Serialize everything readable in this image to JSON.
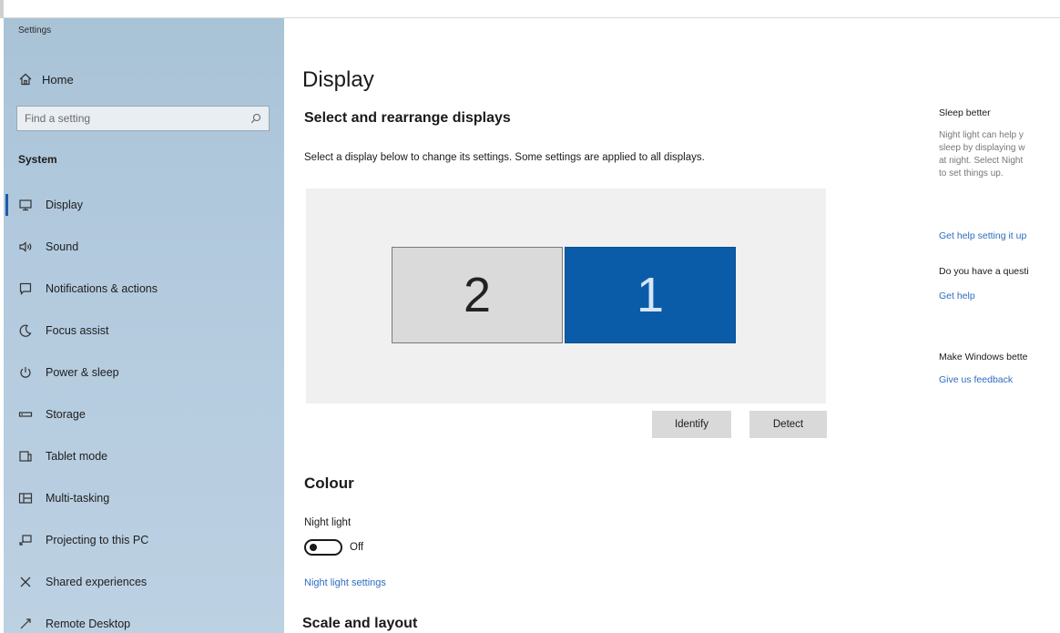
{
  "window": {
    "title": "Settings"
  },
  "sidebar": {
    "home_label": "Home",
    "search_placeholder": "Find a setting",
    "section_label": "System",
    "items": [
      {
        "label": "Display",
        "icon": "monitor-icon",
        "active": true
      },
      {
        "label": "Sound",
        "icon": "speaker-icon"
      },
      {
        "label": "Notifications & actions",
        "icon": "notification-icon"
      },
      {
        "label": "Focus assist",
        "icon": "moon-icon"
      },
      {
        "label": "Power & sleep",
        "icon": "power-icon"
      },
      {
        "label": "Storage",
        "icon": "storage-icon"
      },
      {
        "label": "Tablet mode",
        "icon": "tablet-icon"
      },
      {
        "label": "Multi-tasking",
        "icon": "multitasking-icon"
      },
      {
        "label": "Projecting to this PC",
        "icon": "projecting-icon"
      },
      {
        "label": "Shared experiences",
        "icon": "shared-icon"
      },
      {
        "label": "Remote Desktop",
        "icon": "remote-desktop-icon"
      }
    ]
  },
  "main": {
    "title": "Display",
    "rearrange_heading": "Select and rearrange displays",
    "rearrange_desc": "Select a display below to change its settings. Some settings are applied to all displays.",
    "monitors": [
      {
        "number": "2",
        "selected": false
      },
      {
        "number": "1",
        "selected": true
      }
    ],
    "identify_label": "Identify",
    "detect_label": "Detect",
    "colour_heading": "Colour",
    "night_light_label": "Night light",
    "night_light_state": "Off",
    "night_light_settings_link": "Night light settings",
    "scale_heading": "Scale and layout"
  },
  "right_panel": {
    "sleep_title": "Sleep better",
    "sleep_text": [
      "Night light can help y",
      "sleep by displaying w",
      "at night. Select Night",
      "to set things up."
    ],
    "sleep_link": "Get help setting it up",
    "question_title": "Do you have a questi",
    "question_link": "Get help",
    "feedback_title": "Make Windows bette",
    "feedback_link": "Give us feedback"
  },
  "colors": {
    "accent": "#0a5ca8",
    "link": "#2d6cc0",
    "sidebar_bg": "#b3cade",
    "monitor_inactive": "#dadada",
    "button_bg": "#d9d9d9"
  }
}
